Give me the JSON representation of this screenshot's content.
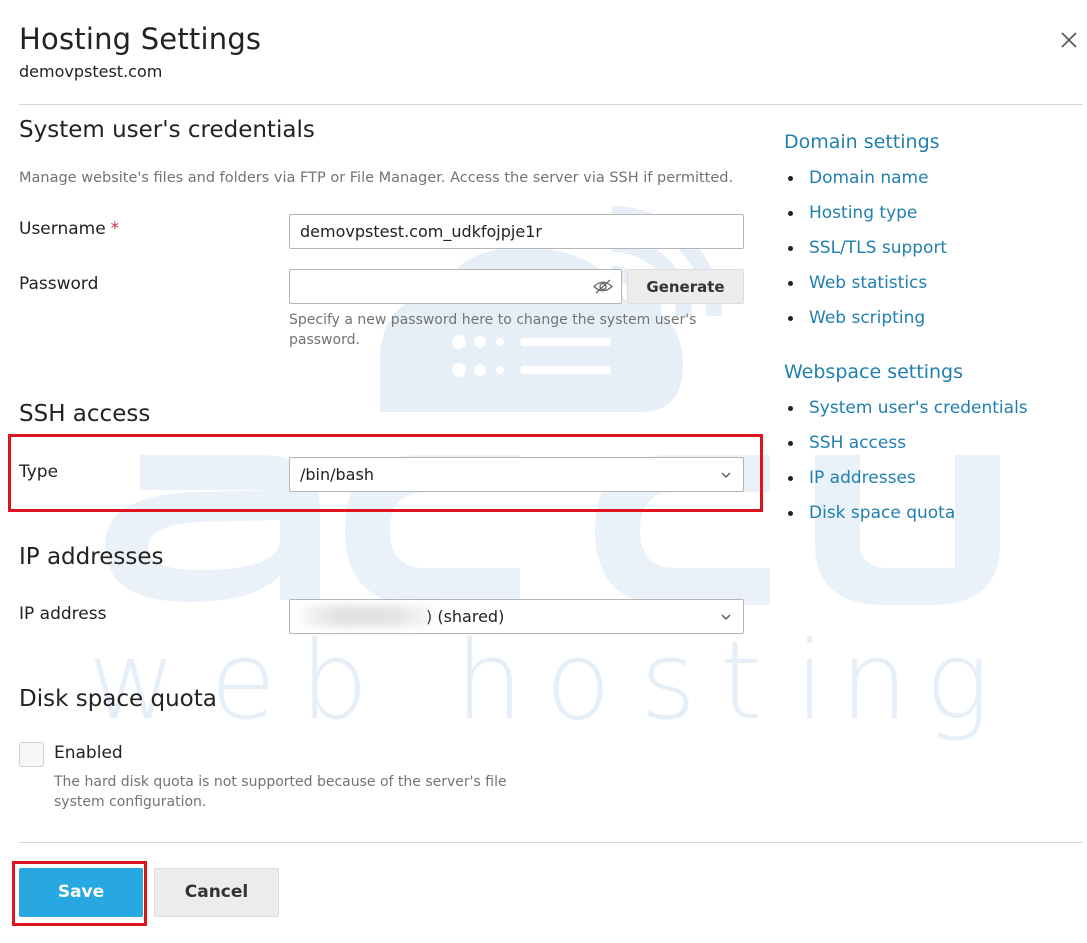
{
  "dialog": {
    "title": "Hosting Settings",
    "subtitle": "demovpstest.com"
  },
  "credentials": {
    "heading": "System user's credentials",
    "description": "Manage website's files and folders via FTP or File Manager. Access the server via SSH if permitted.",
    "username_label": "Username",
    "username_required_mark": "*",
    "username_value": "demovpstest.com_udkfojpje1r",
    "password_label": "Password",
    "password_value": "",
    "generate_label": "Generate",
    "password_hint": "Specify a new password here to change the system user's password."
  },
  "ssh": {
    "heading": "SSH access",
    "type_label": "Type",
    "type_value": "/bin/bash"
  },
  "ip": {
    "heading": "IP addresses",
    "address_label": "IP address",
    "address_value": ") (shared)"
  },
  "quota": {
    "heading": "Disk space quota",
    "enabled_label": "Enabled",
    "enabled_checked": false,
    "hint": "The hard disk quota is not supported because of the server's file system configuration."
  },
  "actions": {
    "save_label": "Save",
    "cancel_label": "Cancel"
  },
  "sidebar": {
    "domain_heading": "Domain settings",
    "domain_items": [
      "Domain name",
      "Hosting type",
      "SSL/TLS support",
      "Web statistics",
      "Web scripting"
    ],
    "webspace_heading": "Webspace settings",
    "webspace_items": [
      "System user's credentials",
      "SSH access",
      "IP addresses",
      "Disk space quota"
    ]
  },
  "watermark": {
    "brand": "accu",
    "tagline": "web hosting"
  },
  "colors": {
    "accent": "#28a8e0",
    "link": "#1f7fae",
    "highlight": "#e0141e",
    "required": "#d02d4c",
    "watermark": "#e6eff8"
  },
  "icons": {
    "close": "close-icon",
    "password_visibility": "eye-off-icon",
    "dropdown": "chevron-down-icon"
  }
}
